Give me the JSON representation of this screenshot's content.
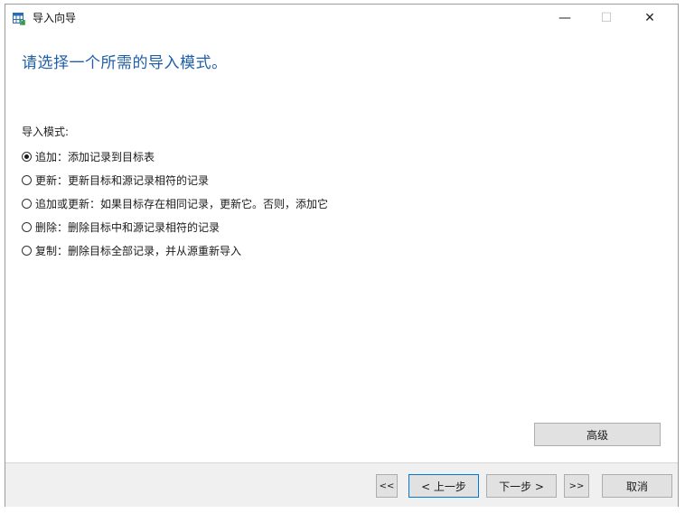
{
  "window": {
    "title": "导入向导",
    "icon": "table-import-icon",
    "controls": {
      "minimize": "—",
      "maximize": "☐",
      "close": "✕"
    }
  },
  "heading": "请选择一个所需的导入模式。",
  "mode_label": "导入模式:",
  "options": [
    {
      "label": "追加：添加记录到目标表",
      "selected": true
    },
    {
      "label": "更新：更新目标和源记录相符的记录",
      "selected": false
    },
    {
      "label": "追加或更新：如果目标存在相同记录，更新它。否则，添加它",
      "selected": false
    },
    {
      "label": "删除：删除目标中和源记录相符的记录",
      "selected": false
    },
    {
      "label": "复制：删除目标全部记录，并从源重新导入",
      "selected": false
    }
  ],
  "buttons": {
    "advanced": "高级",
    "first": "<<",
    "prev": "< 上一步",
    "next": "下一步 >",
    "last": ">>",
    "cancel": "取消"
  }
}
